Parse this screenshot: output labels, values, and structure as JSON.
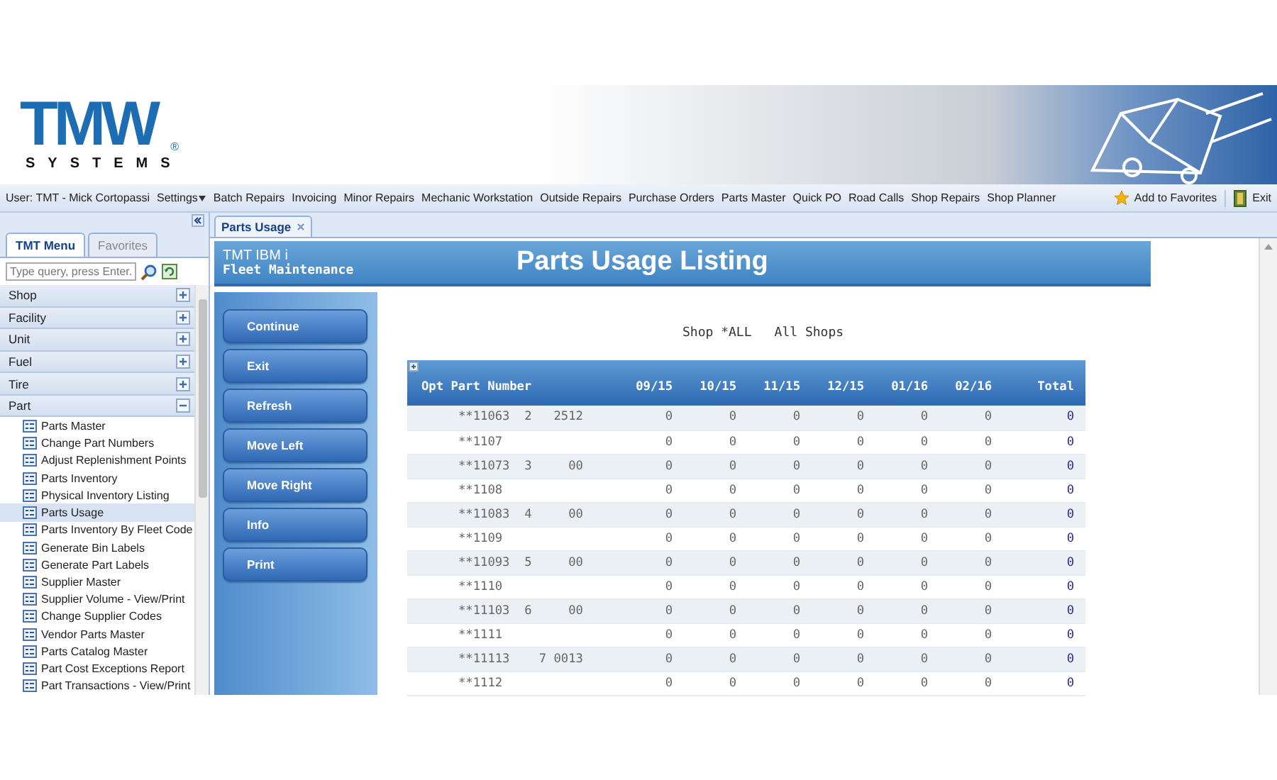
{
  "header": {
    "logo": {
      "wordmark": "TMW",
      "mark": "®",
      "tagline": "SYSTEMS"
    }
  },
  "menu_bar": {
    "user": "User: TMT - Mick Cortopassi",
    "items": [
      {
        "label": "Settings",
        "dropdown": true
      },
      {
        "label": "Batch Repairs",
        "dropdown": false
      },
      {
        "label": "Invoicing",
        "dropdown": false
      },
      {
        "label": "Minor Repairs",
        "dropdown": false
      },
      {
        "label": "Mechanic Workstation",
        "dropdown": false
      },
      {
        "label": "Outside Repairs",
        "dropdown": false
      },
      {
        "label": "Purchase Orders",
        "dropdown": false
      },
      {
        "label": "Parts Master",
        "dropdown": false
      },
      {
        "label": "Quick PO",
        "dropdown": false
      },
      {
        "label": "Road Calls",
        "dropdown": false
      },
      {
        "label": "Shop Repairs",
        "dropdown": false
      },
      {
        "label": "Shop Planner",
        "dropdown": false
      }
    ],
    "actions": [
      {
        "kind": "favorite",
        "label": "Add to Favorites"
      },
      {
        "kind": "exit",
        "label": "Exit"
      }
    ]
  },
  "sidebar": {
    "tabs": [
      {
        "label": "TMT Menu",
        "selected": true
      },
      {
        "label": "Favorites",
        "selected": false
      }
    ],
    "search": {
      "placeholder": "Type query, press Enter."
    },
    "groups": [
      {
        "label": "Shop",
        "expanded": false
      },
      {
        "label": "Facility",
        "expanded": false
      },
      {
        "label": "Unit",
        "expanded": false
      },
      {
        "label": "Fuel",
        "expanded": false
      },
      {
        "label": "Tire",
        "expanded": false
      },
      {
        "label": "Part",
        "expanded": true,
        "children": [
          {
            "label": "Parts Master",
            "selected": false
          },
          {
            "label": "Change Part Numbers",
            "selected": false
          },
          {
            "label": "Adjust Replenishment Points",
            "selected": false
          },
          {
            "label": "Parts Inventory",
            "selected": false
          },
          {
            "label": "Physical Inventory Listing",
            "selected": false
          },
          {
            "label": "Parts Usage",
            "selected": true
          },
          {
            "label": "Parts Inventory By Fleet Code",
            "selected": false
          },
          {
            "label": "Generate Bin Labels",
            "selected": false
          },
          {
            "label": "Generate Part Labels",
            "selected": false
          },
          {
            "label": "Supplier Master",
            "selected": false
          },
          {
            "label": "Supplier Volume - View/Print",
            "selected": false
          },
          {
            "label": "Change Supplier Codes",
            "selected": false
          },
          {
            "label": "Vendor Parts Master",
            "selected": false
          },
          {
            "label": "Parts Catalog Master",
            "selected": false
          },
          {
            "label": "Part Cost Exceptions Report",
            "selected": false
          },
          {
            "label": "Part Transactions - View/Print",
            "selected": false
          }
        ]
      }
    ]
  },
  "document_tabs": [
    {
      "label": "Parts Usage",
      "selected": true
    }
  ],
  "content": {
    "system": "TMT IBM i",
    "module": "Fleet Maintenance",
    "title": "Parts Usage Listing",
    "buttons": [
      "Continue",
      "Exit",
      "Refresh",
      "Move Left",
      "Move Right",
      "Info",
      "Print"
    ],
    "filter": {
      "code": "Shop *ALL",
      "name": "All Shops"
    },
    "table": {
      "columns": [
        "Opt Part Number",
        "09/15",
        "10/15",
        "11/15",
        "12/15",
        "01/16",
        "02/16",
        "Total"
      ],
      "rows": [
        {
          "part": "**11063  2   2512",
          "values": [
            "0",
            "0",
            "0",
            "0",
            "0",
            "0"
          ],
          "total": "0"
        },
        {
          "part": "**1107",
          "values": [
            "0",
            "0",
            "0",
            "0",
            "0",
            "0"
          ],
          "total": "0"
        },
        {
          "part": "**11073  3     00",
          "values": [
            "0",
            "0",
            "0",
            "0",
            "0",
            "0"
          ],
          "total": "0"
        },
        {
          "part": "**1108",
          "values": [
            "0",
            "0",
            "0",
            "0",
            "0",
            "0"
          ],
          "total": "0"
        },
        {
          "part": "**11083  4     00",
          "values": [
            "0",
            "0",
            "0",
            "0",
            "0",
            "0"
          ],
          "total": "0"
        },
        {
          "part": "**1109",
          "values": [
            "0",
            "0",
            "0",
            "0",
            "0",
            "0"
          ],
          "total": "0"
        },
        {
          "part": "**11093  5     00",
          "values": [
            "0",
            "0",
            "0",
            "0",
            "0",
            "0"
          ],
          "total": "0"
        },
        {
          "part": "**1110",
          "values": [
            "0",
            "0",
            "0",
            "0",
            "0",
            "0"
          ],
          "total": "0"
        },
        {
          "part": "**11103  6     00",
          "values": [
            "0",
            "0",
            "0",
            "0",
            "0",
            "0"
          ],
          "total": "0"
        },
        {
          "part": "**1111",
          "values": [
            "0",
            "0",
            "0",
            "0",
            "0",
            "0"
          ],
          "total": "0"
        },
        {
          "part": "**11113    7 0013",
          "values": [
            "0",
            "0",
            "0",
            "0",
            "0",
            "0"
          ],
          "total": "0"
        },
        {
          "part": "**1112",
          "values": [
            "0",
            "0",
            "0",
            "0",
            "0",
            "0"
          ],
          "total": "0"
        }
      ]
    }
  }
}
